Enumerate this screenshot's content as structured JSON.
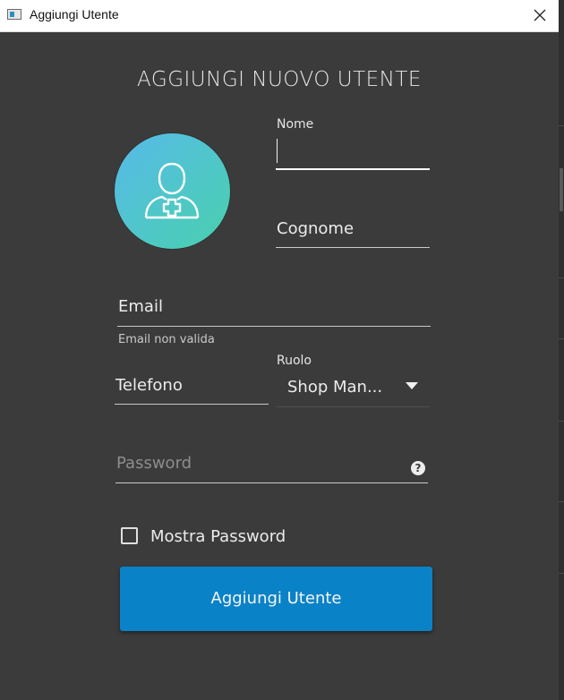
{
  "window": {
    "title": "Aggiungi Utente"
  },
  "form": {
    "heading": "AGGIUNGI NUOVO UTENTE",
    "nome": {
      "label": "Nome",
      "value": ""
    },
    "cognome": {
      "placeholder": "Cognome"
    },
    "email": {
      "placeholder": "Email",
      "error": "Email non valida"
    },
    "telefono": {
      "placeholder": "Telefono"
    },
    "ruolo": {
      "label": "Ruolo",
      "selected": "Shop Man..."
    },
    "password": {
      "placeholder": "Password",
      "help_glyph": "?"
    },
    "show_password": {
      "label": "Mostra Password",
      "checked": false
    },
    "submit_label": "Aggiungi Utente"
  },
  "icons": {
    "app": "app-window-icon",
    "close": "close-icon",
    "avatar": "user-medical-icon",
    "dropdown": "caret-down-icon",
    "help": "help-icon"
  },
  "colors": {
    "background": "#3b3b3b",
    "primary": "#0a82c7",
    "avatar_gradient": [
      "#58b9ea",
      "#49cfae"
    ]
  }
}
